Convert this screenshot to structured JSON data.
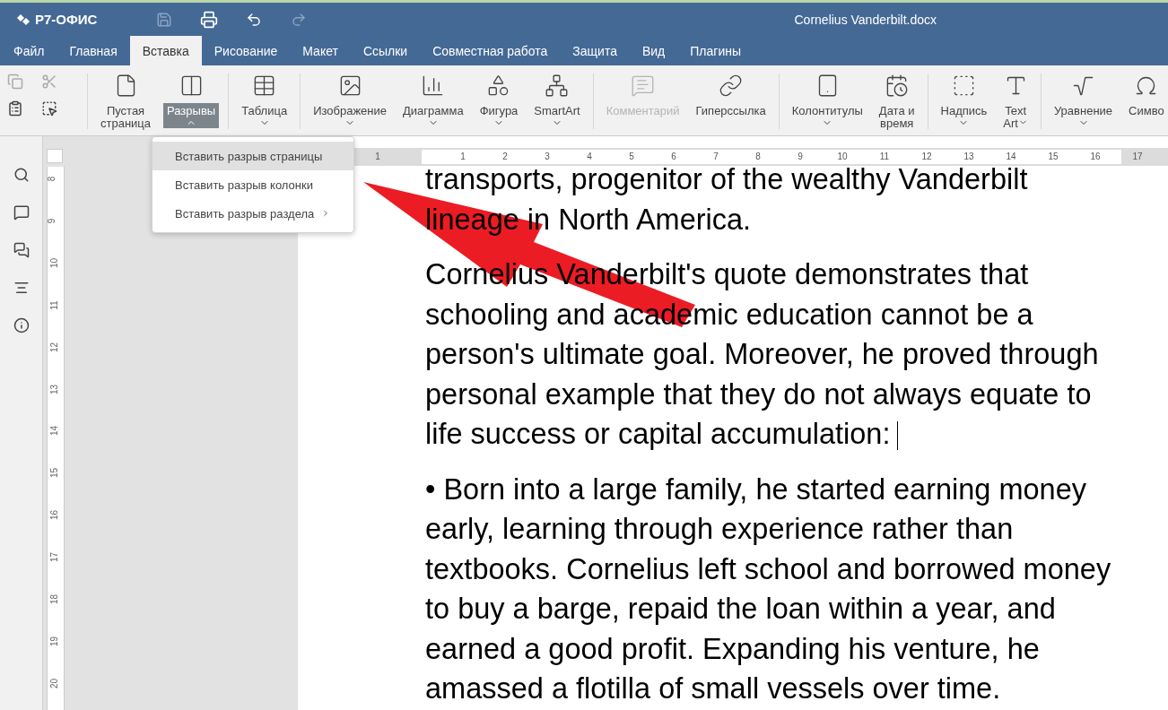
{
  "app": {
    "logo": "Р7-ОФИС",
    "title": "Cornelius Vanderbilt.docx"
  },
  "menu_tabs": [
    {
      "label": "Файл",
      "selected": false
    },
    {
      "label": "Главная",
      "selected": false
    },
    {
      "label": "Вставка",
      "selected": true
    },
    {
      "label": "Рисование",
      "selected": false
    },
    {
      "label": "Макет",
      "selected": false
    },
    {
      "label": "Ссылки",
      "selected": false
    },
    {
      "label": "Совместная работа",
      "selected": false
    },
    {
      "label": "Защита",
      "selected": false
    },
    {
      "label": "Вид",
      "selected": false
    },
    {
      "label": "Плагины",
      "selected": false
    }
  ],
  "toolbar": [
    {
      "lines": [
        "Пустая",
        "страница"
      ],
      "dropdown": false,
      "selected": false,
      "disabled": false,
      "group_start": true
    },
    {
      "lines": [
        "Разрывы"
      ],
      "dropdown": true,
      "selected": true,
      "disabled": false,
      "group_start": false
    },
    {
      "lines": [
        "Таблица"
      ],
      "dropdown": true,
      "selected": false,
      "disabled": false,
      "group_start": true
    },
    {
      "lines": [
        "Изображение"
      ],
      "dropdown": true,
      "selected": false,
      "disabled": false,
      "group_start": true
    },
    {
      "lines": [
        "Диаграмма"
      ],
      "dropdown": true,
      "selected": false,
      "disabled": false,
      "group_start": false
    },
    {
      "lines": [
        "Фигура"
      ],
      "dropdown": true,
      "selected": false,
      "disabled": false,
      "group_start": false
    },
    {
      "lines": [
        "SmartArt"
      ],
      "dropdown": true,
      "selected": false,
      "disabled": false,
      "group_start": false
    },
    {
      "lines": [
        "Комментарий"
      ],
      "dropdown": false,
      "selected": false,
      "disabled": true,
      "group_start": true
    },
    {
      "lines": [
        "Гиперссылка"
      ],
      "dropdown": false,
      "selected": false,
      "disabled": false,
      "group_start": false
    },
    {
      "lines": [
        "Колонтитулы"
      ],
      "dropdown": true,
      "selected": false,
      "disabled": false,
      "group_start": true
    },
    {
      "lines": [
        "Дата и",
        "время"
      ],
      "dropdown": false,
      "selected": false,
      "disabled": false,
      "group_start": false
    },
    {
      "lines": [
        "Надпись"
      ],
      "dropdown": true,
      "selected": false,
      "disabled": false,
      "group_start": true
    },
    {
      "lines": [
        "Text",
        "Art"
      ],
      "dropdown": true,
      "selected": false,
      "disabled": false,
      "group_start": false
    },
    {
      "lines": [
        "Уравнение"
      ],
      "dropdown": true,
      "selected": false,
      "disabled": false,
      "group_start": true
    },
    {
      "lines": [
        "Симво"
      ],
      "dropdown": false,
      "selected": false,
      "disabled": false,
      "group_start": false
    }
  ],
  "breaks_menu": [
    {
      "label": "Вставить разрыв страницы",
      "selected": true,
      "submenu": false
    },
    {
      "label": "Вставить разрыв колонки",
      "selected": false,
      "submenu": false
    },
    {
      "label": "Вставить разрыв раздела",
      "selected": false,
      "submenu": true
    }
  ],
  "horizontal_ruler": [
    "1",
    "1",
    "2",
    "3",
    "4",
    "5",
    "6",
    "7",
    "8",
    "9",
    "10",
    "11",
    "12",
    "13",
    "14",
    "15",
    "16",
    "17"
  ],
  "vertical_ruler": [
    "8",
    "9",
    "10",
    "11",
    "12",
    "13",
    "14",
    "15",
    "16",
    "17",
    "18",
    "19",
    "20"
  ],
  "document": {
    "paragraphs": [
      {
        "text": "transports, progenitor of the wealthy Vanderbilt lineage in North America.",
        "cursor": false
      },
      {
        "text": "Cornelius Vanderbilt's quote demonstrates that schooling and academic education cannot be a person's ultimate goal. Moreover, he proved through personal example that they do not always equate to life success or capital accumulation:",
        "cursor": true
      },
      {
        "text": "• Born into a large family, he started earning money early, learning through experience rather than textbooks. Cornelius left school and borrowed money to buy a barge, repaid the loan within a year, and earned a good profit. Expanding his venture, he amassed a flotilla of small vessels over time.",
        "cursor": false
      }
    ]
  }
}
